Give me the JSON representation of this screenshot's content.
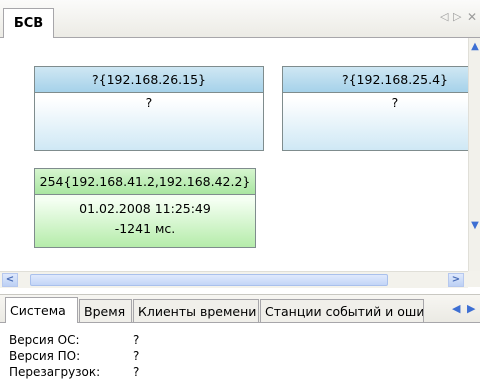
{
  "document_tab": {
    "label": "БСВ"
  },
  "tab_nav": {
    "prev_icon": "triangle-left-icon",
    "next_icon": "triangle-right-icon",
    "close_icon": "close-icon"
  },
  "nodes": [
    {
      "header": "?{192.168.26.15}",
      "lines": [
        "?"
      ],
      "color": "#a6d2ea"
    },
    {
      "header": "?{192.168.25.4}",
      "lines": [
        "?"
      ],
      "color": "#a6d2ea"
    },
    {
      "header": "254{192.168.41.2,192.168.42.2}",
      "lines": [
        "01.02.2008 11:25:49",
        "-1241 мс."
      ],
      "color": "#a9e6a1"
    }
  ],
  "subtabs": [
    {
      "label": "Система",
      "active": true
    },
    {
      "label": "Время",
      "active": false
    },
    {
      "label": "Клиенты времени",
      "active": false
    },
    {
      "label": "Станции событий и ошибок",
      "active": false
    }
  ],
  "info": [
    {
      "label": "Версия ОС:",
      "value": "?"
    },
    {
      "label": "Версия ПО:",
      "value": "?"
    },
    {
      "label": "Перезагрузок:",
      "value": "?"
    }
  ]
}
